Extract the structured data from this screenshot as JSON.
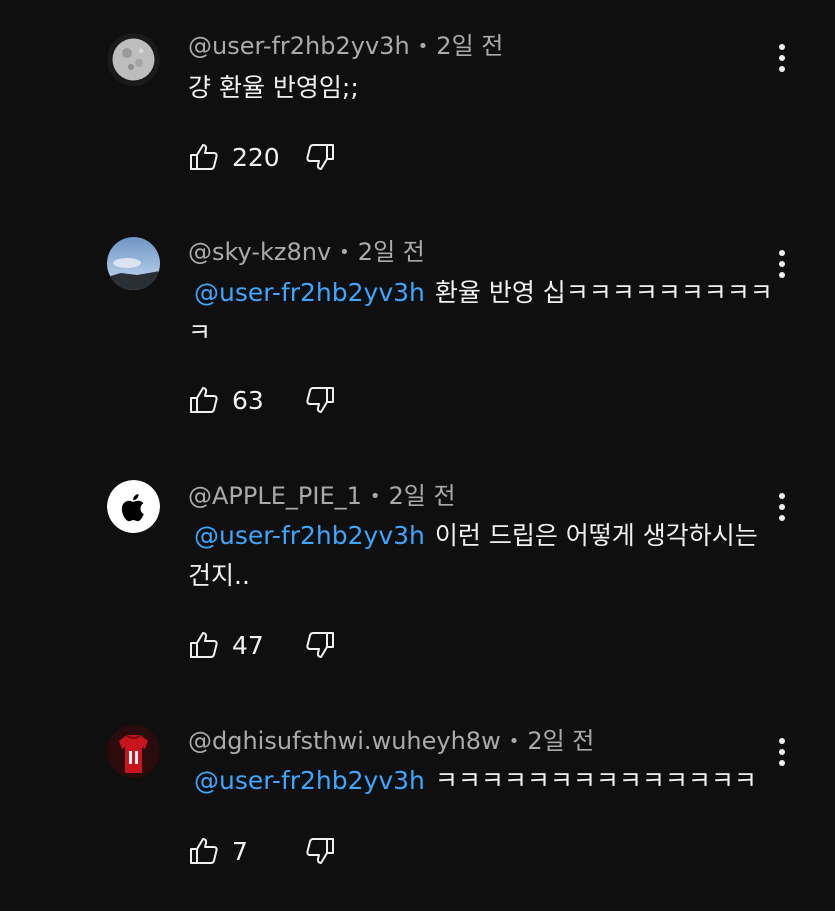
{
  "comments": [
    {
      "author": "@user-fr2hb2yv3h",
      "time": "2일 전",
      "mention": "",
      "text": "걍 환율 반영임;;",
      "likes": "220",
      "avatar": "moon-avatar"
    },
    {
      "author": "@sky-kz8nv",
      "time": "2일 전",
      "mention": "@user-fr2hb2yv3h",
      "text": "환율 반영 십ㅋㅋㅋㅋㅋㅋㅋㅋㅋㅋ",
      "likes": "63",
      "avatar": "sky-avatar"
    },
    {
      "author": "@APPLE_PIE_1",
      "time": "2일 전",
      "mention": "@user-fr2hb2yv3h",
      "text": "이런 드립은 어떻게 생각하시는 건지..",
      "likes": "47",
      "avatar": "apple-avatar"
    },
    {
      "author": "@dghisufsthwi.wuheyh8w",
      "time": "2일 전",
      "mention": "@user-fr2hb2yv3h",
      "text": "ㅋㅋㅋㅋㅋㅋㅋㅋㅋㅋㅋㅋㅋㅋ",
      "likes": "7",
      "avatar": "jersey-avatar"
    }
  ],
  "separator": "•",
  "colors": {
    "background": "#0f0f0f",
    "text": "#f1f1f1",
    "meta": "#aaaaaa",
    "mention": "#3ea6ff"
  },
  "icons": {
    "like": "thumbs-up-icon",
    "dislike": "thumbs-down-icon",
    "more": "more-vert-icon"
  }
}
